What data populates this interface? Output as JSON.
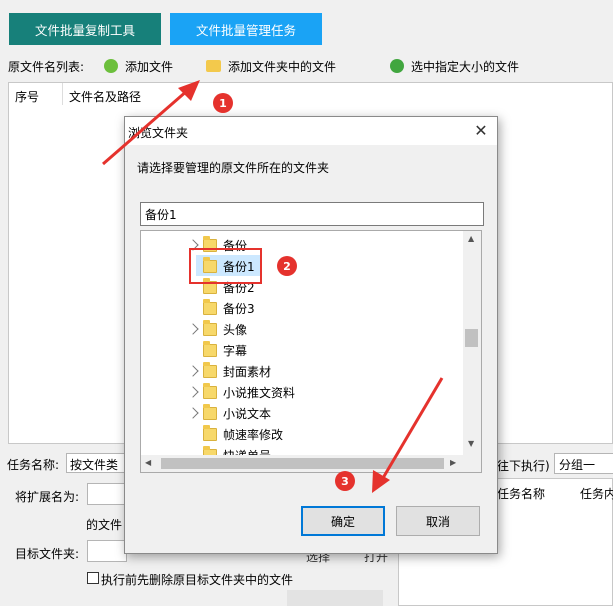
{
  "tabs": [
    {
      "label": "文件批量复制工具"
    },
    {
      "label": "文件批量管理任务"
    }
  ],
  "toolbar": {
    "list_label": "原文件名列表:",
    "add_file": "添加文件",
    "add_folder": "添加文件夹中的文件",
    "select_size": "选中指定大小的文件"
  },
  "table": {
    "col_index": "序号",
    "col_path": "文件名及路径"
  },
  "dialog": {
    "title": "浏览文件夹",
    "prompt": "请选择要管理的原文件所在的文件夹",
    "path_value": "备份1",
    "items": [
      {
        "label": "备份",
        "expandable": true
      },
      {
        "label": "备份1",
        "expandable": false,
        "selected": true
      },
      {
        "label": "备份2",
        "expandable": false
      },
      {
        "label": "备份3",
        "expandable": false
      },
      {
        "label": "头像",
        "expandable": true
      },
      {
        "label": "字幕",
        "expandable": false
      },
      {
        "label": "封面素材",
        "expandable": true
      },
      {
        "label": "小说推文资料",
        "expandable": true
      },
      {
        "label": "小说文本",
        "expandable": true
      },
      {
        "label": "帧速率修改",
        "expandable": false
      },
      {
        "label": "快递单号",
        "expandable": false
      }
    ],
    "ok": "确定",
    "cancel": "取消"
  },
  "bottom": {
    "task_name_label": "任务名称:",
    "task_name_value": "按文件类型",
    "ext_label": "将扩展名为:",
    "file_label": "的文件",
    "target_label": "目标文件夹:",
    "delete_check": "执行前先删除原目标文件夹中的文件",
    "exec_text": "往下执行)",
    "group_select": "分组一",
    "col_task_name": "任务名称",
    "col_task_content": "任务内",
    "btn_select": "选择",
    "btn_open": "打开"
  },
  "badges": [
    "1",
    "2",
    "3"
  ],
  "colors": {
    "tab1": "#17807a",
    "tab2": "#1aa3f5",
    "annotation": "#e5322d"
  }
}
